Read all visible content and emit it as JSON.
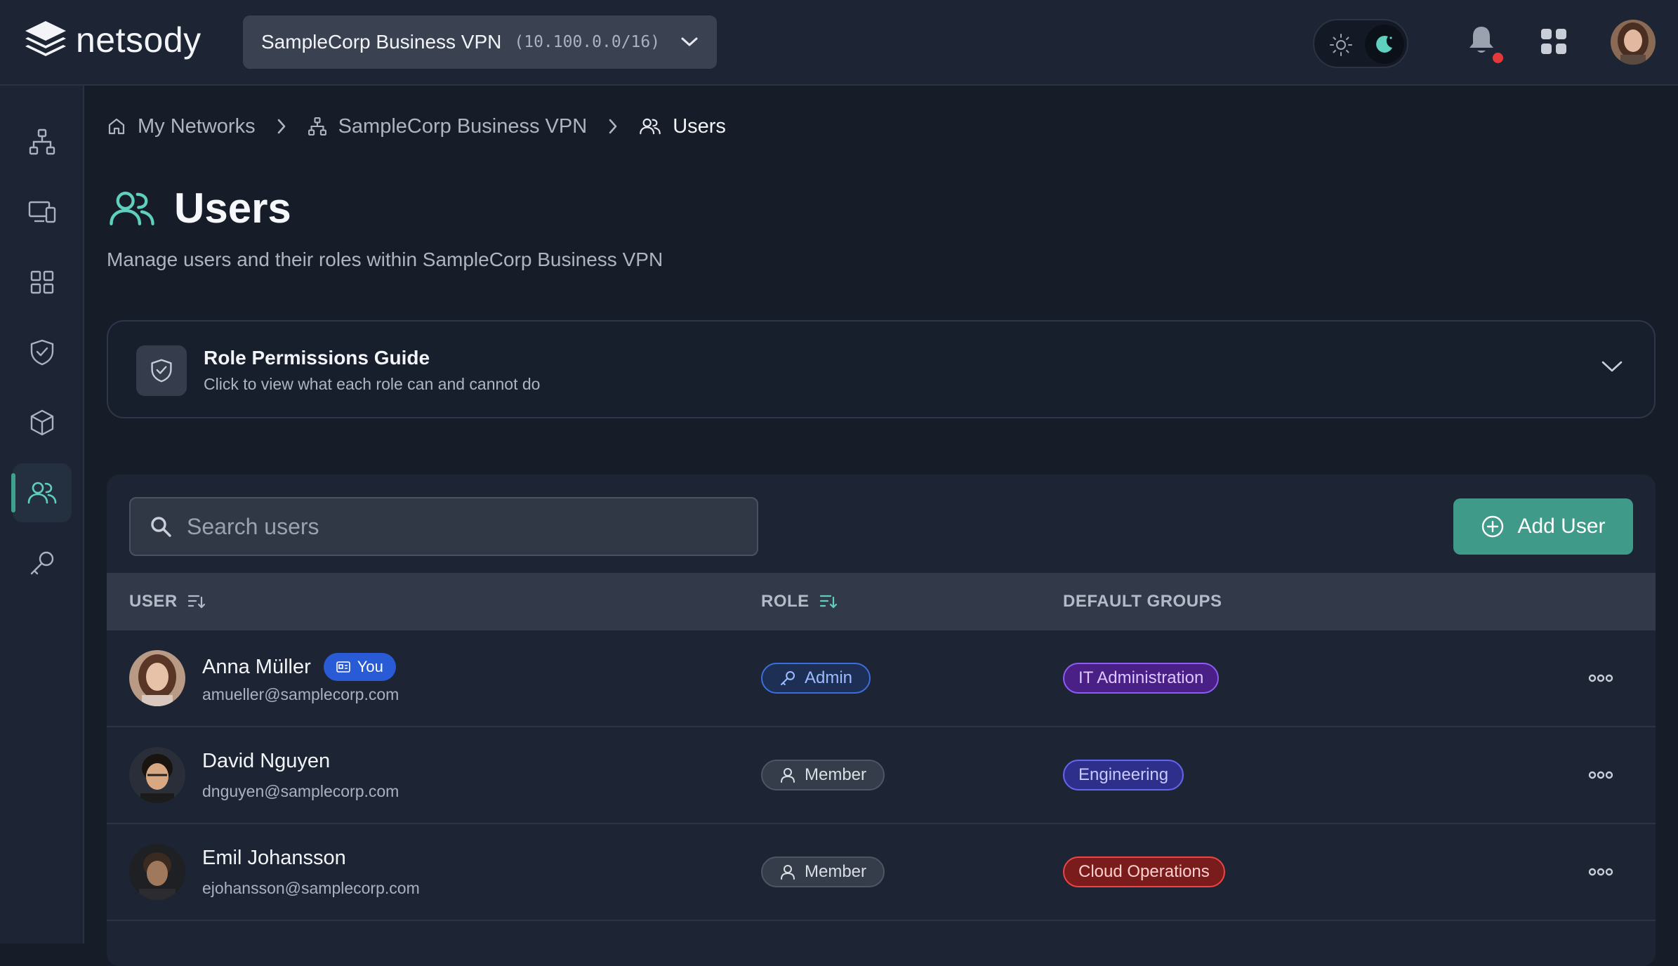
{
  "app": {
    "brand": "netsody"
  },
  "network_selector": {
    "name": "SampleCorp Business VPN",
    "cidr": "(10.100.0.0/16)"
  },
  "theme": {
    "mode": "dark"
  },
  "sidebar": {
    "items": [
      {
        "icon": "network-topology-icon"
      },
      {
        "icon": "devices-icon"
      },
      {
        "icon": "apps-grid-icon"
      },
      {
        "icon": "shield-check-icon"
      },
      {
        "icon": "cube-icon"
      },
      {
        "icon": "users-icon",
        "active": true
      },
      {
        "icon": "key-icon"
      }
    ]
  },
  "breadcrumb": {
    "items": [
      {
        "label": "My Networks",
        "icon": "home-icon"
      },
      {
        "label": "SampleCorp Business VPN",
        "icon": "network-topology-icon"
      },
      {
        "label": "Users",
        "icon": "users-icon"
      }
    ]
  },
  "page": {
    "title": "Users",
    "subtitle": "Manage users and their roles within SampleCorp Business VPN"
  },
  "guide": {
    "title": "Role Permissions Guide",
    "subtitle": "Click to view what each role can and cannot do"
  },
  "search": {
    "placeholder": "Search users",
    "value": ""
  },
  "actions": {
    "add_user": "Add User"
  },
  "table": {
    "columns": {
      "user": "USER",
      "role": "ROLE",
      "groups": "DEFAULT GROUPS"
    },
    "rows": [
      {
        "name": "Anna Müller",
        "email": "amueller@samplecorp.com",
        "you": "You",
        "role": "Admin",
        "group": "IT Administration",
        "group_color": "#8b5cf6"
      },
      {
        "name": "David Nguyen",
        "email": "dnguyen@samplecorp.com",
        "role": "Member",
        "group": "Engineering",
        "group_color": "#6366f1"
      },
      {
        "name": "Emil Johansson",
        "email": "ejohansson@samplecorp.com",
        "role": "Member",
        "group": "Cloud Operations",
        "group_color": "#ef4444"
      }
    ]
  },
  "colors": {
    "accent": "#3f9a8a",
    "background": "#161c28",
    "notification_dot": "#e5383b"
  }
}
